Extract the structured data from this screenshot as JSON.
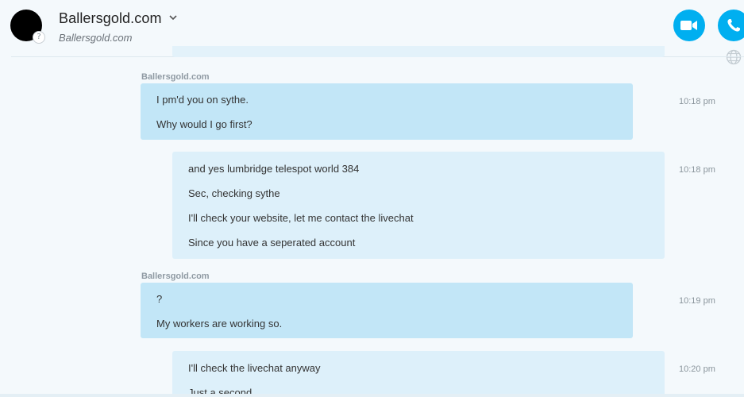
{
  "header": {
    "contact_name": "Ballersgold.com",
    "contact_subtitle": "Ballersgold.com",
    "status_symbol": "?",
    "icons": [
      "chevron-down-icon",
      "video-icon",
      "phone-icon",
      "globe-icon"
    ],
    "accent_color": "#00aff0"
  },
  "messages": [
    {
      "sender": "Ballersgold.com",
      "direction": "incoming",
      "time": "10:18 pm",
      "lines": [
        "I pm'd you on sythe.",
        "Why would I go first?"
      ]
    },
    {
      "sender": "",
      "direction": "outgoing",
      "time": "10:18 pm",
      "lines": [
        "and yes lumbridge telespot world 384",
        "Sec, checking sythe",
        "I'll check your website, let me contact the livechat",
        "Since you have a seperated account"
      ]
    },
    {
      "sender": "Ballersgold.com",
      "direction": "incoming",
      "time": "10:19 pm",
      "lines": [
        "?",
        "My workers are working so."
      ]
    },
    {
      "sender": "",
      "direction": "outgoing",
      "time": "10:20 pm",
      "lines": [
        "I'll check the livechat anyway",
        "Just a second"
      ]
    }
  ],
  "colors": {
    "incoming_bubble": "#c2e6f7",
    "outgoing_bubble": "#ddf0fa",
    "background": "#f4f9fc"
  }
}
